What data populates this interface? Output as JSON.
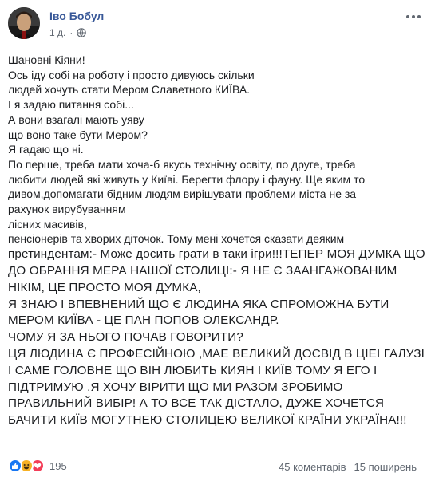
{
  "post": {
    "author": "Іво Бобул",
    "timestamp": "1 д.",
    "privacy_icon": "globe-icon",
    "lines": [
      "Шановні Кіяни!",
      "Ось іду собі на роботу і просто дивуюсь скільки",
      "людей хочуть стати Мером Славетного КИЇВА.",
      "І я задаю питання собі...",
      "А вони взагалі мають уяву",
      "що воно таке бути Мером?",
      "Я гадаю що ні.",
      "По перше, треба мати хоча-б якусь технічну освіту, по друге, треба",
      "любити людей які живуть у Київі. Берегти флору і фауну. Ще яким то",
      "дивом,допомагати бідним людям вирішувати проблеми міста не за",
      "рахунок вирубуванням",
      "лісних масивів,",
      "пенсіонерів та хворих діточок. Тому мені хочется сказати деяким",
      "претиндентам:- Може досить грати в таки ігри!!!ТЕПЕР МОЯ ДУМКА ЩО",
      "ДО ОБРАННЯ МЕРА НАШОЇ СТОЛИЦІ:- Я НЕ Є ЗААНГАЖОВАНИМ",
      "НІКІМ, ЦЕ ПРОСТО МОЯ ДУМКА,",
      "Я ЗНАЮ І ВПЕВНЕНИЙ ЩО Є ЛЮДИНА ЯКА СПРОМОЖНА БУТИ",
      "МЕРОМ КИЇВА - ЦЕ ПАН ПОПОВ ОЛЕКСАНДР.",
      "ЧОМУ Я ЗА НЬОГО ПОЧАВ ГОВОРИТИ?",
      "ЦЯ ЛЮДИНА Є ПРОФЕСІЙНОЮ ,МАЕ ВЕЛИКИЙ ДОСВІД В ЦІЕІ ГАЛУЗІ",
      "І САМЕ ГОЛОВНЕ ЩО ВІН ЛЮБИТЬ КИЯН І КИЇВ ТОМУ Я ЕГО І",
      "ПІДТРИМУЮ ,Я ХОЧУ ВІРИТИ ЩО МИ РАЗОМ ЗРОБИМО",
      "ПРАВИЛЬНИЙ ВИБІР! А ТО ВСЕ ТАК ДІСТАЛО, ДУЖЕ ХОЧЕТСЯ",
      "БАЧИТИ КИЇВ МОГУТНЕЮ СТОЛИЦЕЮ ВЕЛИКОЇ КРАЇНИ УКРАЇНА!!!"
    ]
  },
  "footer": {
    "reaction_icons": [
      "like-icon",
      "haha-icon",
      "love-icon"
    ],
    "reaction_count": "195",
    "comments": "45 коментарів",
    "shares": "15 поширень"
  },
  "colors": {
    "author_link": "#385898",
    "meta_text": "#606770",
    "like": "#1877f2",
    "haha": "#f7b125",
    "love": "#f33e58"
  }
}
